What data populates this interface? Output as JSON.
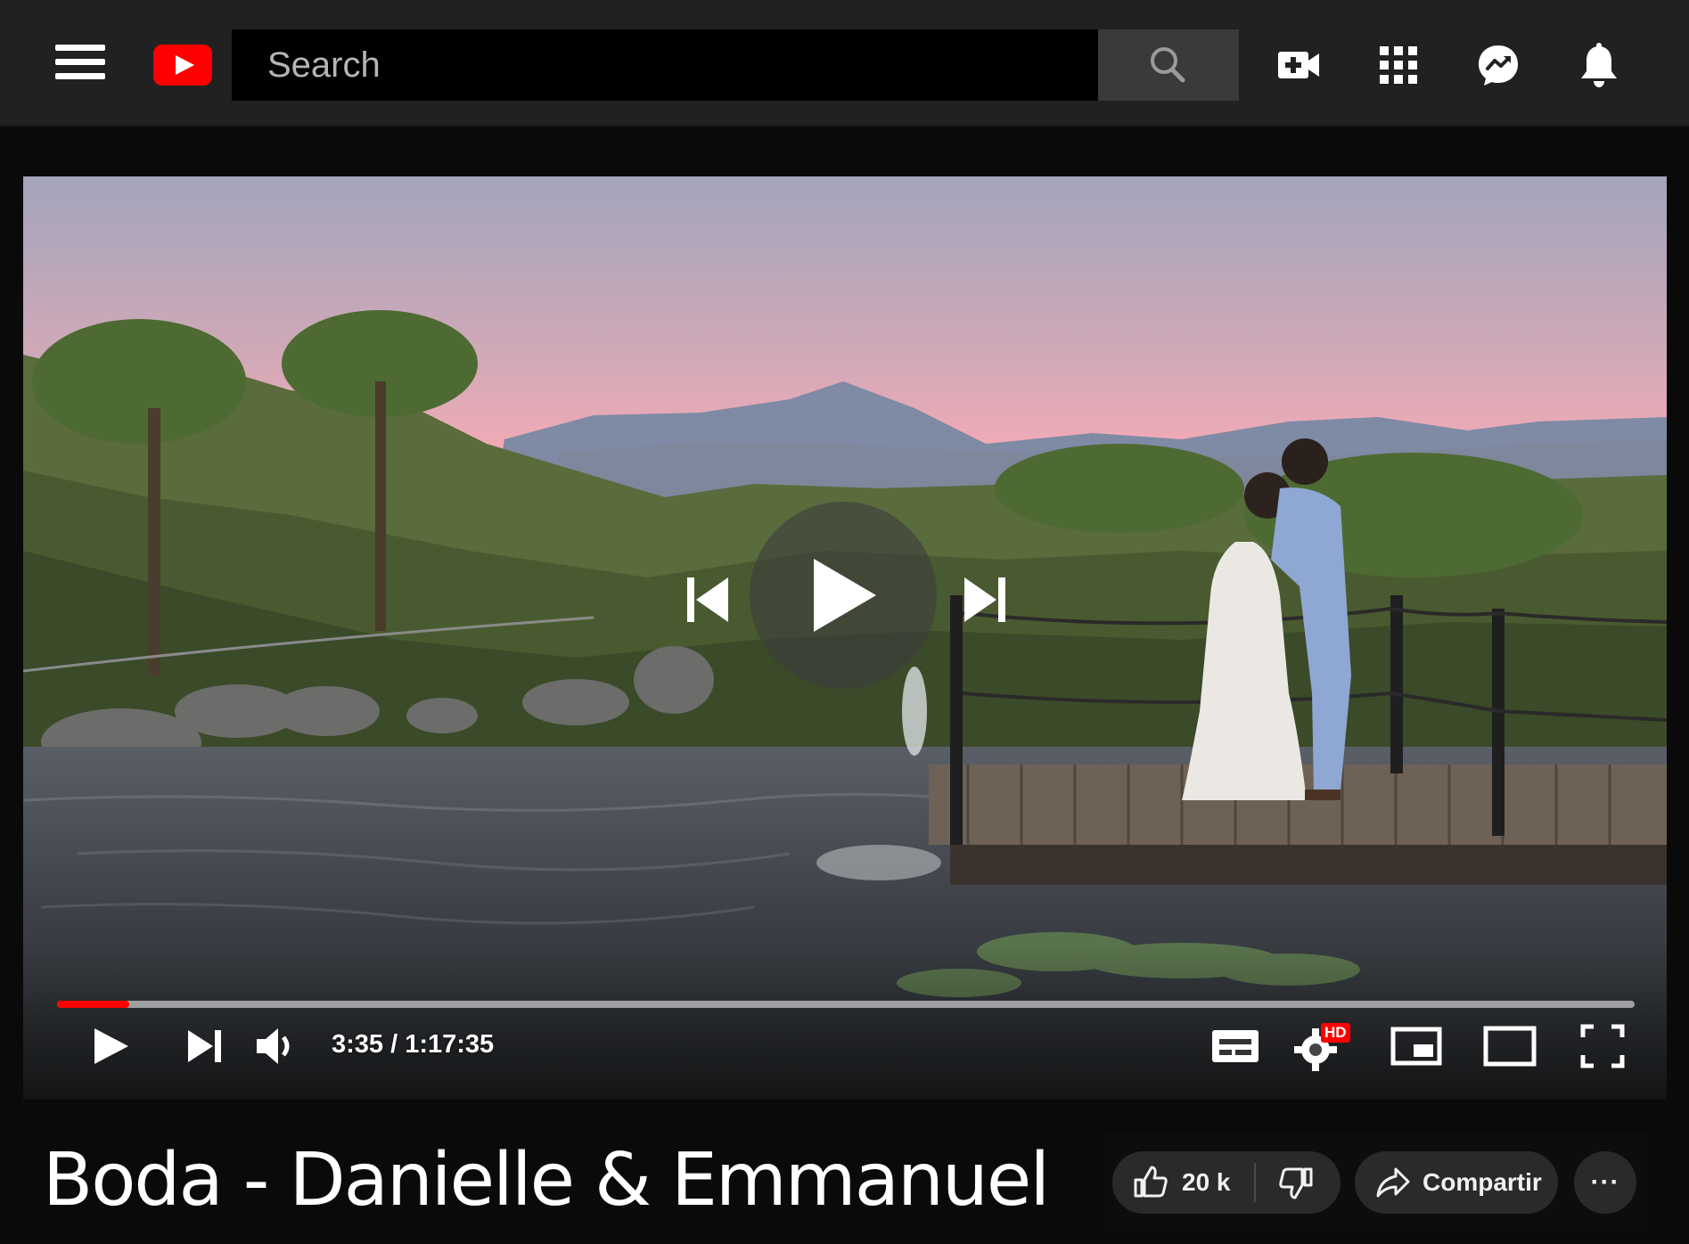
{
  "header": {
    "menu_icon": "hamburger-menu-icon",
    "logo_icon": "youtube-logo-icon",
    "search": {
      "placeholder": "Search",
      "button_icon": "search-icon"
    },
    "icons": [
      "create-video-icon",
      "apps-grid-icon",
      "messenger-icon",
      "notifications-bell-icon"
    ]
  },
  "player": {
    "center_controls": [
      "previous-icon",
      "play-icon",
      "next-icon"
    ],
    "time": {
      "current": "3:35",
      "separator": " / ",
      "total": "1:17:35"
    },
    "progress_fraction": 0.046,
    "quality_badge": "HD",
    "bar_icons": [
      "play-icon",
      "next-icon",
      "volume-icon",
      "subtitles-icon",
      "settings-icon",
      "miniplayer-icon",
      "theater-mode-icon",
      "fullscreen-icon"
    ]
  },
  "video": {
    "title": "Boda - Danielle & Emmanuel",
    "likes": "20 k",
    "share_label": "Compartir",
    "more_label": "···"
  },
  "colors": {
    "accent": "#ff0000",
    "topbar": "#212121",
    "page_bg": "#0a0a0a"
  }
}
